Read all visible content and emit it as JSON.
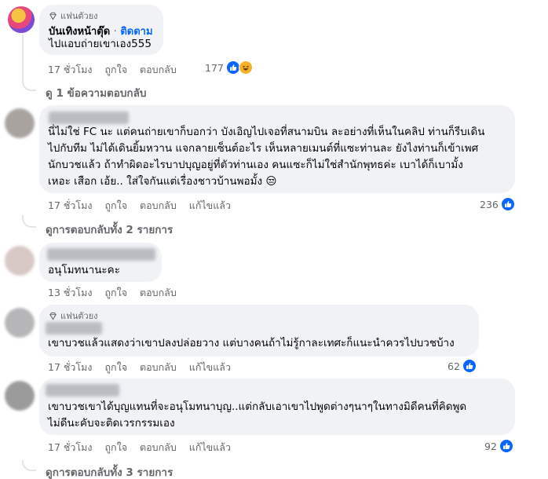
{
  "colors": {
    "accent": "#0866ff",
    "bubble": "#f0f2f5",
    "muted": "#65676b"
  },
  "icons": {
    "fan_badge": "diamond-icon",
    "like": "thumbs-up-icon",
    "haha": "laughing-face-icon"
  },
  "comments": [
    {
      "badge": "แฟนตัวยง",
      "name": "บันเทิงหน้าตุ๊ด",
      "follow_sep": "·",
      "follow": "ติดตาม",
      "text": "ไปแอบถ่ายเขาเอง555",
      "time": "17 ชั่วโมง",
      "like": "ถูกใจ",
      "reply": "ตอบกลับ",
      "reaction_count": "177",
      "replies_link": "ดู 1 ข้อความตอบกลับ"
    },
    {
      "lines": [
        "นี่ไม่ใช่ FC นะ แต่คนถ่ายเขาก็บอกว่า บังเอิญไปเจอที่สนามบิน ละอย่างที่เห็นในคลิป ท่านก็รีบเดิน",
        "ไปกับทีม ไม่ได้เดินยิ้มหวาน แจกลายเซ็นต์อะไร เห็นหลายเมนต์ที่แซะท่านละ ยังไงท่านก็เข้าเพศ",
        "นักบวชแล้ว ถ้าทำผิดอะไรบาปบุญอยู่ที่ตัวท่านเอง คนแซะก็ไม่ใช่สำนักพุทธค่ะ เบาได้ก็เบามั้ง",
        "เหอะ เสือก เอ้ย.. ใส่ใจกันแต่เรื่องชาวบ้านพอมั้ง 😒"
      ],
      "time": "17 ชั่วโมง",
      "like": "ถูกใจ",
      "reply": "ตอบกลับ",
      "edited": "แก้ไขแล้ว",
      "reaction_count": "236",
      "replies_link": "ดูการตอบกลับทั้ง 2 รายการ"
    },
    {
      "text": "อนุโมทนานะคะ",
      "time": "13 ชั่วโมง",
      "like": "ถูกใจ",
      "reply": "ตอบกลับ"
    },
    {
      "badge": "แฟนตัวยง",
      "text": "เขาบวชแล้วแสดงว่าเขาปลงปล่อยวาง แต่บางคนถ้าไม่รู้กาละเทศะก็แนะนำควรไปบวชบ้าง",
      "time": "17 ชั่วโมง",
      "like": "ถูกใจ",
      "reply": "ตอบกลับ",
      "edited": "แก้ไขแล้ว",
      "reaction_count": "62"
    },
    {
      "lines": [
        "เขาบวชเขาได้บุญแทนที่จะอนุโมทนาบุญ..แต่กลับเอาเขาไปพูดต่างๆนาๆในทางมิดีคนที่คิดพูด",
        "ไม่ดีนะคับจะติดเวรกรรมเอง"
      ],
      "time": "17 ชั่วโมง",
      "like": "ถูกใจ",
      "reply": "ตอบกลับ",
      "edited": "แก้ไขแล้ว",
      "reaction_count": "92",
      "replies_link": "ดูการตอบกลับทั้ง 3 รายการ"
    }
  ]
}
